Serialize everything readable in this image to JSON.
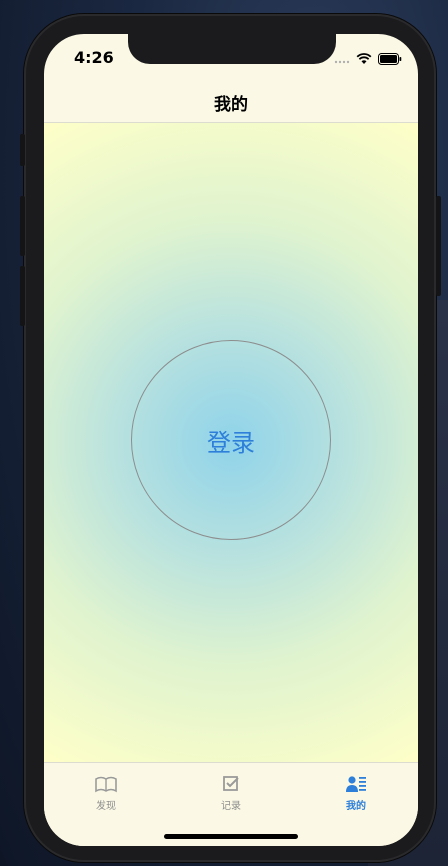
{
  "status_bar": {
    "time": "4:26"
  },
  "nav": {
    "title": "我的"
  },
  "main": {
    "login_label": "登录"
  },
  "tabbar": {
    "items": [
      {
        "label": "发现",
        "icon": "book-icon",
        "active": false
      },
      {
        "label": "记录",
        "icon": "checkbox-icon",
        "active": false
      },
      {
        "label": "我的",
        "icon": "profile-list-icon",
        "active": true
      }
    ]
  },
  "colors": {
    "accent": "#2d7fd9",
    "inactive": "#8e8e8e",
    "bar_background": "#fbf9e6"
  }
}
